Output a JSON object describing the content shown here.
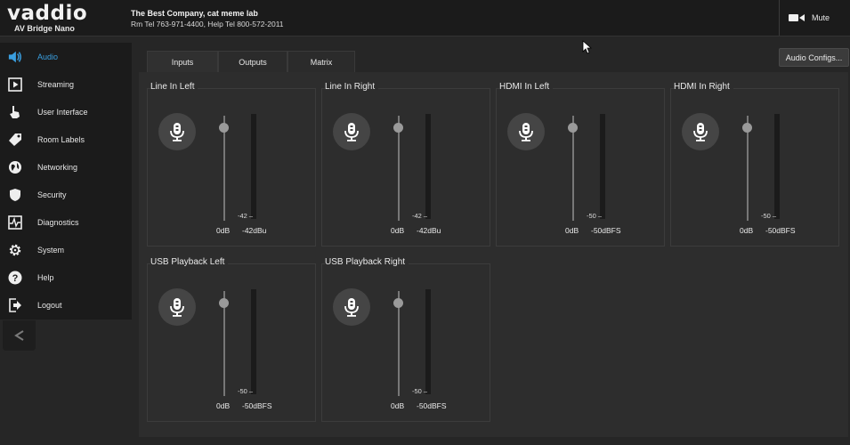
{
  "header": {
    "logo": "vaddio",
    "product": "AV Bridge Nano",
    "company": "The Best Company, cat meme lab",
    "phone": "Rm Tel 763-971-4400, Help Tel 800-572-2011",
    "mute_label": "Mute"
  },
  "sidebar": {
    "items": [
      {
        "label": "Audio",
        "icon": "speaker-icon",
        "active": true
      },
      {
        "label": "Streaming",
        "icon": "play-icon"
      },
      {
        "label": "User Interface",
        "icon": "hand-pointer-icon"
      },
      {
        "label": "Room Labels",
        "icon": "tag-icon"
      },
      {
        "label": "Networking",
        "icon": "globe-icon"
      },
      {
        "label": "Security",
        "icon": "shield-icon"
      },
      {
        "label": "Diagnostics",
        "icon": "pulse-icon"
      },
      {
        "label": "System",
        "icon": "gear-icon"
      },
      {
        "label": "Help",
        "icon": "question-icon"
      },
      {
        "label": "Logout",
        "icon": "logout-icon"
      }
    ],
    "collapse_icon": "chevron-left-icon"
  },
  "tabs": [
    {
      "label": "Inputs",
      "active": true
    },
    {
      "label": "Outputs",
      "active": false
    },
    {
      "label": "Matrix",
      "active": false
    }
  ],
  "audio_configs_label": "Audio Configs...",
  "channels": [
    {
      "title": "Line In Left",
      "gain": "0dB",
      "meter_value": "-42",
      "level": "-42dBu"
    },
    {
      "title": "Line In Right",
      "gain": "0dB",
      "meter_value": "-42",
      "level": "-42dBu"
    },
    {
      "title": "HDMI In Left",
      "gain": "0dB",
      "meter_value": "-50",
      "level": "-50dBFS"
    },
    {
      "title": "HDMI In Right",
      "gain": "0dB",
      "meter_value": "-50",
      "level": "-50dBFS"
    },
    {
      "title": "USB Playback Left",
      "gain": "0dB",
      "meter_value": "-50",
      "level": "-50dBFS"
    },
    {
      "title": "USB Playback Right",
      "gain": "0dB",
      "meter_value": "-50",
      "level": "-50dBFS"
    }
  ],
  "colors": {
    "accent": "#3a9fe0",
    "background": "#262626",
    "panel": "#2d2d2d"
  }
}
